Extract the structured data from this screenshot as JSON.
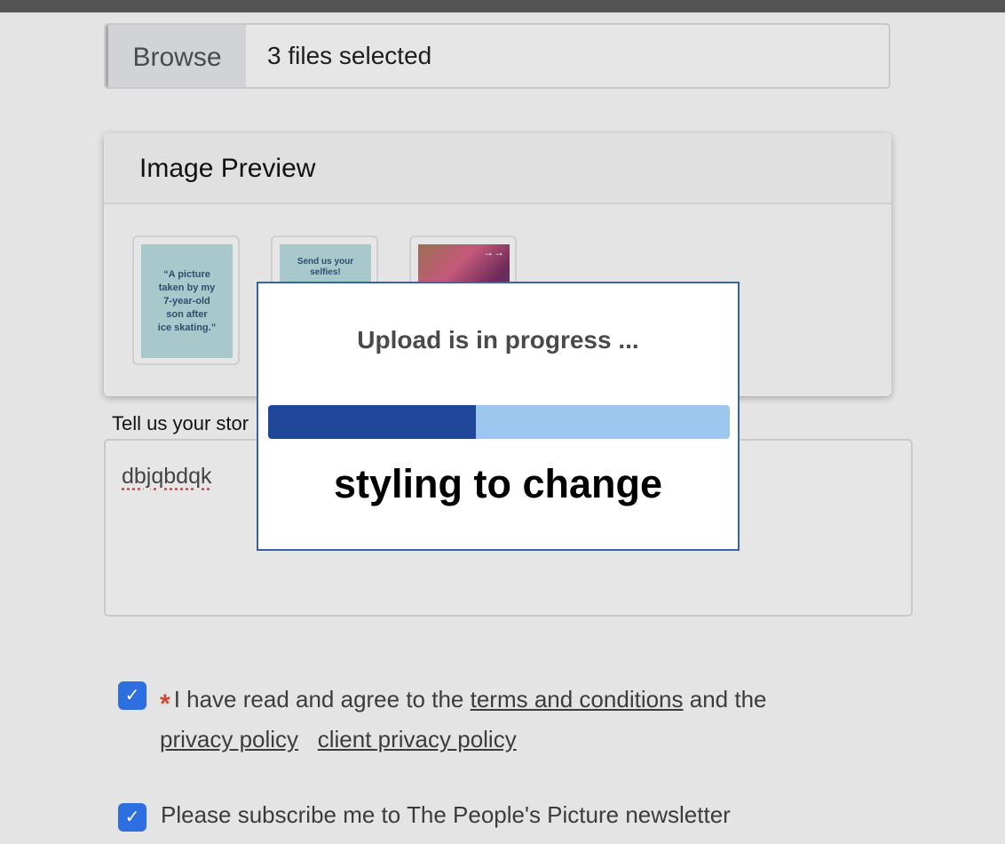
{
  "file_input": {
    "button_label": "Browse",
    "status": "3 files selected"
  },
  "preview": {
    "title": "Image Preview",
    "thumbnails": [
      {
        "lines": [
          "“A picture",
          "taken by my",
          "7-year-old",
          "son after",
          "ice skating.”"
        ]
      },
      {
        "lines": [
          "Send us your",
          "selfies!"
        ]
      },
      {
        "type": "photo",
        "overlay": "→→"
      }
    ]
  },
  "story": {
    "label": "Tell us your stor",
    "value": "dbjqbdqk"
  },
  "consent": {
    "asterisk": "*",
    "text_before": "I have read and agree to the ",
    "terms_link": "terms and conditions",
    "text_after": " and the",
    "privacy_link": "privacy policy",
    "client_privacy_link": "client privacy policy",
    "checked": true
  },
  "newsletter": {
    "label": "Please subscribe me to The People's Picture newsletter",
    "checked": true
  },
  "modal": {
    "title": "Upload is in progress ...",
    "progress": 0.45,
    "note": "styling to change"
  },
  "colors": {
    "accent": "#2d6ee0",
    "progress_fill": "#1f4699",
    "progress_track": "#9ec7ef",
    "required": "#d04a2f"
  }
}
